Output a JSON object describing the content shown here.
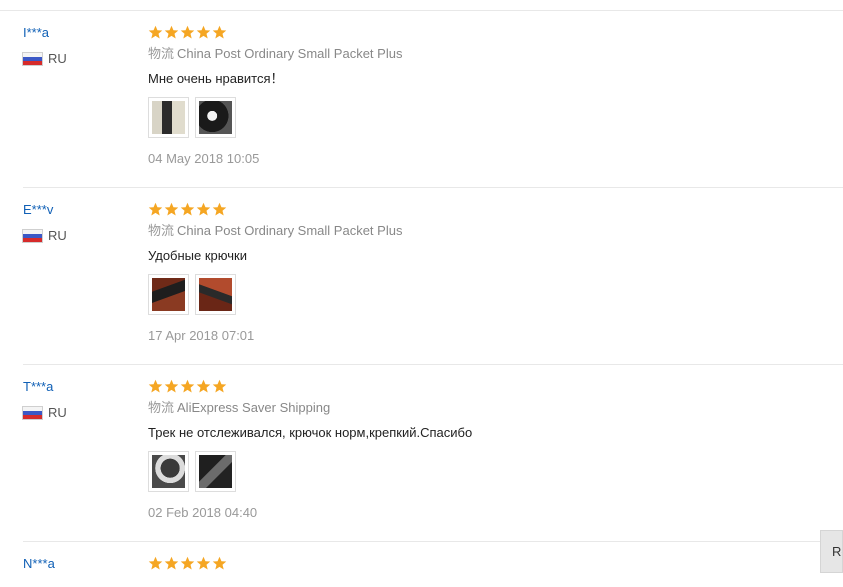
{
  "reviews": [
    {
      "user": "I***a",
      "country": "RU",
      "rating": 5,
      "shipping_label": "物流",
      "shipping_method": "China Post Ordinary Small Packet Plus",
      "comment": "Мне очень нравится！",
      "photos": [
        "photo-1",
        "photo-2"
      ],
      "date": "04 May 2018 10:05"
    },
    {
      "user": "E***v",
      "country": "RU",
      "rating": 5,
      "shipping_label": "物流",
      "shipping_method": "China Post Ordinary Small Packet Plus",
      "comment": "Удобные крючки",
      "photos": [
        "photo-1",
        "photo-2"
      ],
      "date": "17 Apr 2018 07:01"
    },
    {
      "user": "T***a",
      "country": "RU",
      "rating": 5,
      "shipping_label": "物流",
      "shipping_method": "AliExpress Saver Shipping",
      "comment": "Трек не отслеживался, крючок норм,крепкий.Спасибо",
      "photos": [
        "photo-1",
        "photo-2"
      ],
      "date": "02 Feb 2018 04:40"
    },
    {
      "user": "N***a",
      "rating": 5
    }
  ],
  "corner_button": {
    "label": "Re"
  },
  "colors": {
    "star": "#f5a623",
    "username": "#1060b6",
    "divider": "#e8e8e8"
  }
}
